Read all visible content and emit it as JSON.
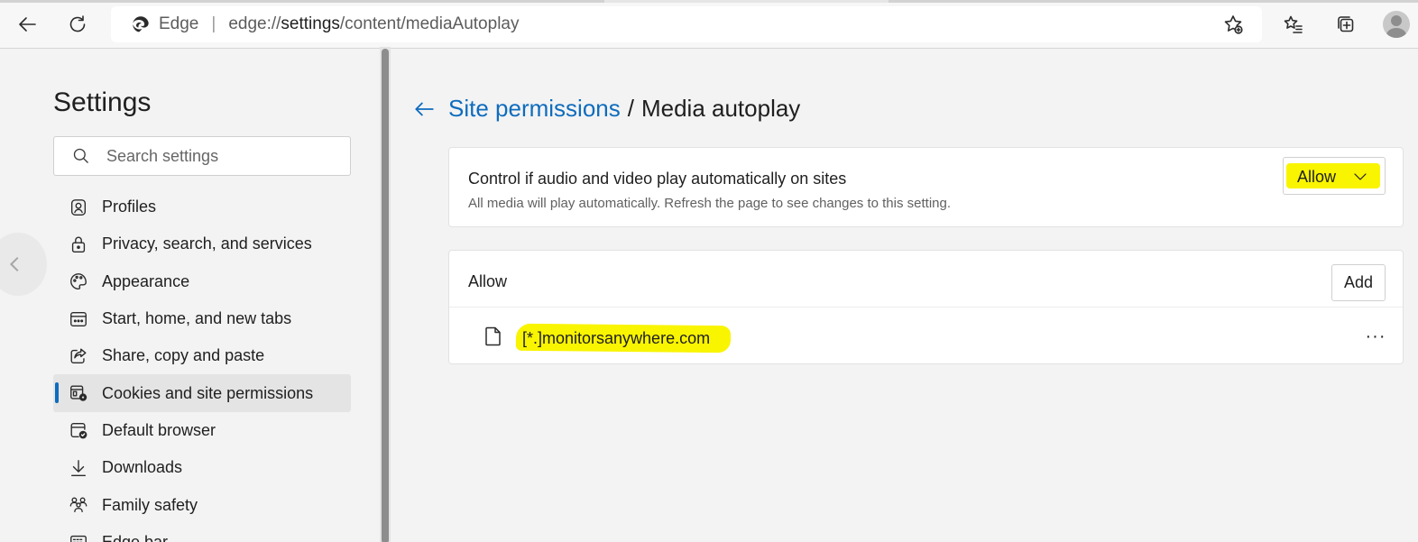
{
  "browser": {
    "brand": "Edge",
    "url_prefix": "edge://",
    "url_bold": "settings",
    "url_suffix": "/content/mediaAutoplay"
  },
  "sidebar": {
    "title": "Settings",
    "search_placeholder": "Search settings",
    "items": [
      {
        "label": "Profiles",
        "icon": "profile-icon"
      },
      {
        "label": "Privacy, search, and services",
        "icon": "lock-icon"
      },
      {
        "label": "Appearance",
        "icon": "palette-icon"
      },
      {
        "label": "Start, home, and new tabs",
        "icon": "window-grid-icon"
      },
      {
        "label": "Share, copy and paste",
        "icon": "share-icon"
      },
      {
        "label": "Cookies and site permissions",
        "icon": "cookies-gear-icon",
        "active": true
      },
      {
        "label": "Default browser",
        "icon": "browser-check-icon"
      },
      {
        "label": "Downloads",
        "icon": "download-icon"
      },
      {
        "label": "Family safety",
        "icon": "family-icon"
      },
      {
        "label": "Edge bar",
        "icon": "keyboard-icon"
      }
    ]
  },
  "main": {
    "breadcrumb_link": "Site permissions",
    "breadcrumb_sep": "/",
    "breadcrumb_current": "Media autoplay",
    "control": {
      "title": "Control if audio and video play automatically on sites",
      "subtitle": "All media will play automatically. Refresh the page to see changes to this setting.",
      "selected": "Allow"
    },
    "allow_list": {
      "heading": "Allow",
      "add_label": "Add",
      "sites": [
        "[*.]monitorsanywhere.com"
      ],
      "more_label": "···"
    }
  },
  "colors": {
    "accent": "#0f6cbd",
    "highlight": "#f9f400"
  }
}
